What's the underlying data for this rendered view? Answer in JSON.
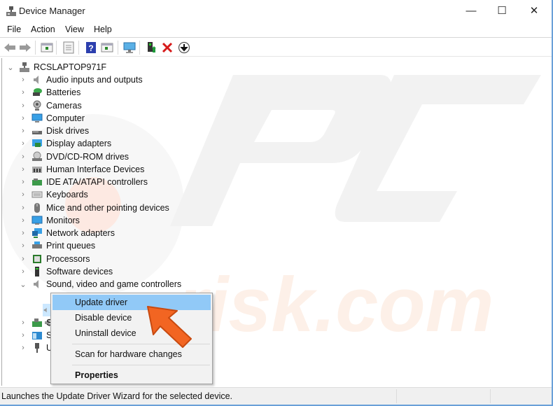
{
  "window": {
    "title": "Device Manager",
    "controls": {
      "minimize": "—",
      "maximize": "☐",
      "close": "✕"
    }
  },
  "menubar": {
    "items": [
      {
        "label": "File"
      },
      {
        "label": "Action"
      },
      {
        "label": "View"
      },
      {
        "label": "Help"
      }
    ]
  },
  "toolbar": {
    "buttons": [
      {
        "icon": "back-arrow-icon"
      },
      {
        "icon": "forward-arrow-icon"
      },
      {
        "icon": "show-hide-console-tree-icon"
      },
      {
        "icon": "properties-icon"
      },
      {
        "icon": "help-icon"
      },
      {
        "icon": "show-hide-action-pane-icon"
      },
      {
        "icon": "scan-hardware-icon"
      },
      {
        "icon": "update-driver-icon"
      },
      {
        "icon": "uninstall-device-icon"
      },
      {
        "icon": "disable-device-icon"
      }
    ],
    "colors": {
      "help": "#2c3fae",
      "uninstall": "#d61a1a",
      "update": "#1f9a3a"
    }
  },
  "tree": {
    "root": {
      "label": "RCSLAPTOP971F",
      "expanded": true
    },
    "categories": [
      {
        "label": "Audio inputs and outputs",
        "icon": "speaker-icon",
        "expanded": false
      },
      {
        "label": "Batteries",
        "icon": "battery-icon",
        "expanded": false
      },
      {
        "label": "Cameras",
        "icon": "camera-icon",
        "expanded": false
      },
      {
        "label": "Computer",
        "icon": "computer-icon",
        "expanded": false
      },
      {
        "label": "Disk drives",
        "icon": "disk-drive-icon",
        "expanded": false
      },
      {
        "label": "Display adapters",
        "icon": "display-adapter-icon",
        "expanded": false
      },
      {
        "label": "DVD/CD-ROM drives",
        "icon": "dvd-drive-icon",
        "expanded": false
      },
      {
        "label": "Human Interface Devices",
        "icon": "hid-icon",
        "expanded": false
      },
      {
        "label": "IDE ATA/ATAPI controllers",
        "icon": "ide-controller-icon",
        "expanded": false
      },
      {
        "label": "Keyboards",
        "icon": "keyboard-icon",
        "expanded": false
      },
      {
        "label": "Mice and other pointing devices",
        "icon": "mouse-icon",
        "expanded": false
      },
      {
        "label": "Monitors",
        "icon": "monitor-icon",
        "expanded": false
      },
      {
        "label": "Network adapters",
        "icon": "network-adapter-icon",
        "expanded": false
      },
      {
        "label": "Print queues",
        "icon": "printer-icon",
        "expanded": false
      },
      {
        "label": "Processors",
        "icon": "processor-icon",
        "expanded": false
      },
      {
        "label": "Software devices",
        "icon": "software-device-icon",
        "expanded": false
      },
      {
        "label": "Sound, video and game controllers",
        "icon": "speaker-icon",
        "expanded": true
      }
    ],
    "sound_children": [
      {
        "label": "",
        "icon": "speaker-icon",
        "selected": true
      },
      {
        "label": "",
        "icon": "speaker-icon",
        "selected": false
      }
    ],
    "trailing_categories": [
      {
        "label": "S",
        "icon": "storage-controller-icon",
        "expanded": false
      },
      {
        "label": "S",
        "icon": "system-devices-icon",
        "expanded": false
      },
      {
        "label": "U",
        "icon": "usb-icon",
        "expanded": false
      }
    ]
  },
  "context_menu": {
    "items": [
      {
        "label": "Update driver",
        "highlighted": true
      },
      {
        "label": "Disable device"
      },
      {
        "label": "Uninstall device"
      },
      {
        "label": "Scan for hardware changes"
      },
      {
        "label": "Properties",
        "bold": true
      }
    ],
    "highlight_color": "#91c9f7"
  },
  "annotation": {
    "icon": "pointer-arrow-icon",
    "color": "#f26522"
  },
  "watermark": {
    "text_top": "PC",
    "text_bottom": "risk.com"
  },
  "statusbar": {
    "text": "Launches the Update Driver Wizard for the selected device."
  }
}
